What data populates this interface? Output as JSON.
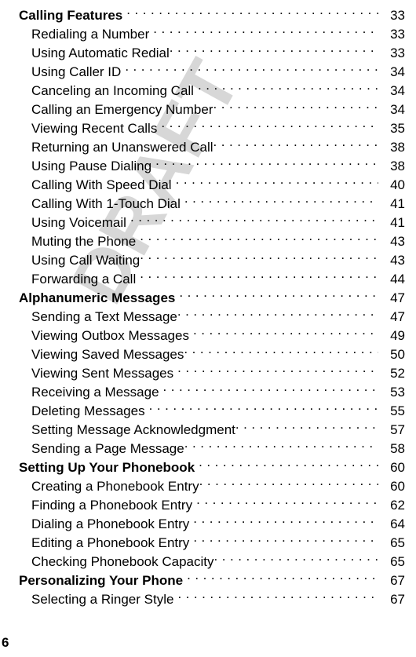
{
  "document": {
    "page_number": "6",
    "watermark_text": "DRAFT",
    "watermark_color": "#d7d7d7",
    "leader_char": "."
  },
  "toc": {
    "entries": [
      {
        "level": 1,
        "label": "Calling Features",
        "page": "33",
        "gap": true
      },
      {
        "level": 2,
        "label": "Redialing a Number",
        "page": "33",
        "gap": true
      },
      {
        "level": 2,
        "label": "Using Automatic Redial",
        "page": "33",
        "gap": false
      },
      {
        "level": 2,
        "label": "Using Caller ID",
        "page": "34",
        "gap": true
      },
      {
        "level": 2,
        "label": "Canceling an Incoming Call",
        "page": "34",
        "gap": true
      },
      {
        "level": 2,
        "label": "Calling an Emergency Number",
        "page": "34",
        "gap": false
      },
      {
        "level": 2,
        "label": "Viewing Recent Calls",
        "page": "35",
        "gap": true
      },
      {
        "level": 2,
        "label": "Returning an Unanswered Call",
        "page": "38",
        "gap": false
      },
      {
        "level": 2,
        "label": "Using Pause Dialing",
        "page": "38",
        "gap": true
      },
      {
        "level": 2,
        "label": "Calling With Speed Dial",
        "page": "40",
        "gap": true
      },
      {
        "level": 2,
        "label": "Calling With 1-Touch Dial",
        "page": "41",
        "gap": true
      },
      {
        "level": 2,
        "label": "Using Voicemail",
        "page": "41",
        "gap": true
      },
      {
        "level": 2,
        "label": "Muting the Phone",
        "page": "43",
        "gap": true
      },
      {
        "level": 2,
        "label": "Using Call Waiting",
        "page": "43",
        "gap": false
      },
      {
        "level": 2,
        "label": "Forwarding a Call",
        "page": "44",
        "gap": true
      },
      {
        "level": 1,
        "label": "Alphanumeric Messages",
        "page": "47",
        "gap": true
      },
      {
        "level": 2,
        "label": "Sending a Text Message",
        "page": "47",
        "gap": false
      },
      {
        "level": 2,
        "label": "Viewing Outbox Messages",
        "page": "49",
        "gap": true
      },
      {
        "level": 2,
        "label": "Viewing Saved Messages",
        "page": "50",
        "gap": false
      },
      {
        "level": 2,
        "label": "Viewing Sent Messages",
        "page": "52",
        "gap": true
      },
      {
        "level": 2,
        "label": "Receiving a Message",
        "page": "53",
        "gap": true
      },
      {
        "level": 2,
        "label": "Deleting Messages",
        "page": "55",
        "gap": true
      },
      {
        "level": 2,
        "label": "Setting Message Acknowledgment",
        "page": "57",
        "gap": false
      },
      {
        "level": 2,
        "label": "Sending a Page Message",
        "page": "58",
        "gap": false
      },
      {
        "level": 1,
        "label": "Setting Up Your Phonebook",
        "page": "60",
        "gap": true
      },
      {
        "level": 2,
        "label": "Creating a Phonebook Entry",
        "page": "60",
        "gap": false
      },
      {
        "level": 2,
        "label": "Finding a Phonebook Entry",
        "page": "62",
        "gap": true
      },
      {
        "level": 2,
        "label": "Dialing a Phonebook Entry",
        "page": "64",
        "gap": true
      },
      {
        "level": 2,
        "label": "Editing a Phonebook Entry",
        "page": "65",
        "gap": true
      },
      {
        "level": 2,
        "label": "Checking Phonebook Capacity",
        "page": "65",
        "gap": false
      },
      {
        "level": 1,
        "label": "Personalizing Your Phone",
        "page": "67",
        "gap": true
      },
      {
        "level": 2,
        "label": "Selecting a Ringer Style",
        "page": "67",
        "gap": true
      }
    ]
  }
}
